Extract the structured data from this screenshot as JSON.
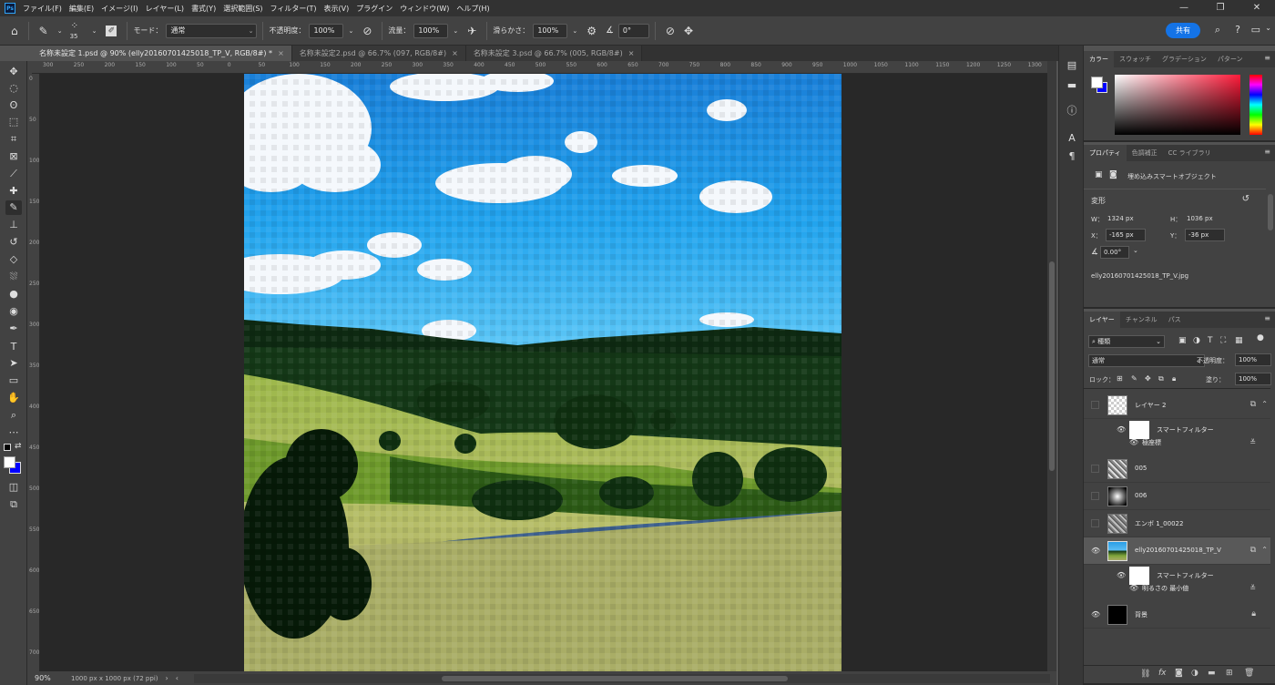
{
  "menubar": {
    "logo": "Ps",
    "items": [
      "ファイル(F)",
      "編集(E)",
      "イメージ(I)",
      "レイヤー(L)",
      "書式(Y)",
      "選択範囲(S)",
      "フィルター(T)",
      "表示(V)",
      "プラグイン",
      "ウィンドウ(W)",
      "ヘルプ(H)"
    ],
    "window_controls": [
      "—",
      "❐",
      "✕"
    ]
  },
  "options": {
    "brush_size": "35",
    "mode_label": "モード：",
    "mode_value": "通常",
    "opacity_label": "不透明度：",
    "opacity_value": "100%",
    "flow_label": "流量：",
    "flow_value": "100%",
    "smoothing_label": "滑らかさ：",
    "smoothing_value": "100%",
    "angle_value": "0°",
    "share_label": "共有"
  },
  "tabs": [
    {
      "label": "名称未設定 1.psd @ 90% (elly20160701425018_TP_V, RGB/8#) *",
      "active": true
    },
    {
      "label": "名称未設定2.psd @ 66.7% (097, RGB/8#)",
      "active": false
    },
    {
      "label": "名称未設定 3.psd @ 66.7% (005, RGB/8#)",
      "active": false
    }
  ],
  "ruler_h_ticks": [
    "300",
    "250",
    "200",
    "150",
    "100",
    "50",
    "0",
    "50",
    "100",
    "150",
    "200",
    "250",
    "300",
    "350",
    "400",
    "450",
    "500",
    "550",
    "600",
    "650",
    "700",
    "750",
    "800",
    "850",
    "900",
    "950",
    "1000",
    "1050",
    "1100",
    "1150",
    "1200",
    "1250",
    "1300"
  ],
  "ruler_v_ticks": [
    "0",
    "50",
    "100",
    "150",
    "200",
    "250",
    "300",
    "350",
    "400",
    "450",
    "500",
    "550",
    "600",
    "650",
    "700"
  ],
  "status": {
    "zoom": "90%",
    "doc_info": "1000 px x 1000 px (72 ppi)"
  },
  "color_panel": {
    "tabs": [
      "カラー",
      "スウォッチ",
      "グラデーション",
      "パターン"
    ],
    "foreground": "#ffffff",
    "background": "#0000ff"
  },
  "properties_panel": {
    "tabs": [
      "プロパティ",
      "色調補正",
      "CC ライブラリ"
    ],
    "type_label": "埋め込みスマートオブジェクト",
    "section": "変形",
    "w_label": "W：",
    "w_value": "1324 px",
    "h_label": "H：",
    "h_value": "1036 px",
    "x_label": "X：",
    "x_value": "-165 px",
    "y_label": "Y：",
    "y_value": "-36 px",
    "angle_value": "0.00°",
    "filename": "elly20160701425018_TP_V.jpg"
  },
  "layers_panel": {
    "tabs": [
      "レイヤー",
      "チャンネル",
      "パス"
    ],
    "filter_label": "種類",
    "blend_mode": "通常",
    "opacity_label": "不透明度：",
    "opacity_value": "100%",
    "lock_label": "ロック：",
    "fill_label": "塗り：",
    "fill_value": "100%",
    "layers": [
      {
        "name": "レイヤー 2",
        "visible": false
      },
      {
        "name": "005",
        "visible": false
      },
      {
        "name": "006",
        "visible": false
      },
      {
        "name": "エンボ 1_00022",
        "visible": false
      },
      {
        "name": "elly20160701425018_TP_V",
        "visible": true
      },
      {
        "name": "背景",
        "visible": true
      }
    ],
    "smart_filter_label": "スマートフィルター",
    "filter_1": "極座標",
    "filter_2": "明るさの 最小値"
  },
  "colors": {
    "accent": "#1473e6",
    "panel_bg": "#424242",
    "canvas_bg": "#282828"
  }
}
